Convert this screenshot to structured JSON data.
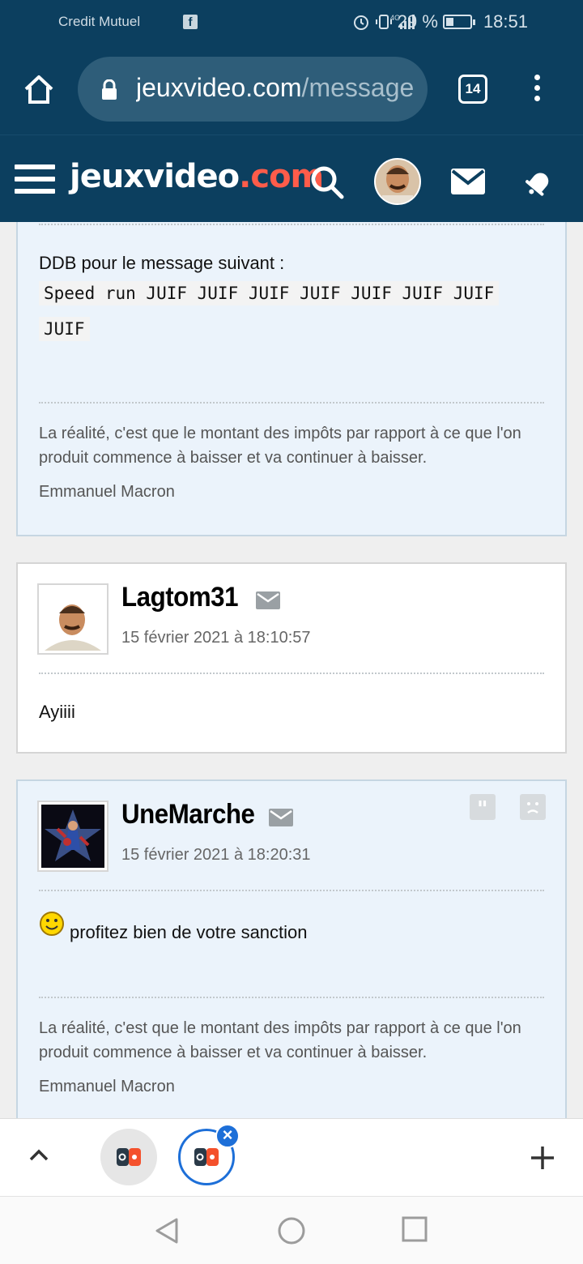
{
  "statusbar": {
    "carrier": "Credit Mutuel",
    "network": "4G",
    "battery": "29 %",
    "battery_level": 0.29,
    "time": "18:51"
  },
  "browser": {
    "url_domain": "jeuxvideo.com",
    "url_rest": "/message",
    "tab_count": "14"
  },
  "site": {
    "logo_main": "jeuxvideo",
    "logo_dot": ".com",
    "brand_color": "#0c3f5f",
    "accent_color": "#ff5c4a"
  },
  "posts": [
    {
      "message_intro": "DDB pour le message suivant :",
      "code_line1": "Speed run JUIF JUIF JUIF JUIF JUIF JUIF JUIF",
      "code_line2": "JUIF",
      "signature": "La réalité, c'est que le montant des impôts par rapport à ce que l'on produit commence à baisser et va continuer à baisser.",
      "signature_author": "Emmanuel Macron"
    },
    {
      "author": "Lagtom31",
      "date": "15 février 2021 à 18:10:57",
      "message": "Ayiiii"
    },
    {
      "author": "UneMarche",
      "date": "15 février 2021 à 18:20:31",
      "message": "profitez bien de votre sanction",
      "signature": "La réalité, c'est que le montant des impôts par rapport à ce que l'on produit commence à baisser et va continuer à baisser.",
      "signature_author": "Emmanuel Macron"
    }
  ],
  "icons": {
    "home": "home-icon",
    "lock": "lock-icon",
    "menu": "menu-icon",
    "search": "search-icon",
    "mail": "mail-icon",
    "bell": "bell-icon",
    "quote": "quote-icon",
    "report": "report-icon",
    "smiley": "smiley-icon"
  }
}
